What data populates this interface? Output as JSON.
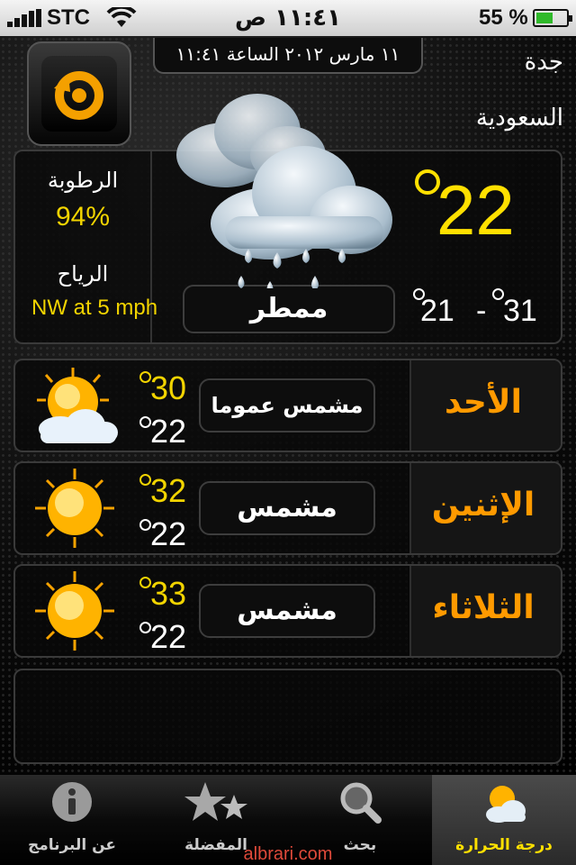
{
  "status_bar": {
    "carrier": "STC",
    "time": "١١:٤١ ص",
    "battery": "55 %",
    "battery_level": 0.55
  },
  "header": {
    "datetime": "١١ مارس ٢٠١٢ الساعة ١١:٤١",
    "city": "جدة",
    "country": "السعودية"
  },
  "current": {
    "humidity_label": "الرطوبة",
    "humidity_value": "94%",
    "wind_label": "الرياح",
    "wind_value": "NW at 5 mph",
    "temp": "22",
    "condition": "ممطر",
    "high": "31",
    "low": "21",
    "icon": "rain-cloud-icon"
  },
  "forecast": [
    {
      "day": "الأحد",
      "condition": "مشمس عموما",
      "high": "30",
      "low": "22",
      "icon": "partly-sunny-icon"
    },
    {
      "day": "الإثنين",
      "condition": "مشمس",
      "high": "32",
      "low": "22",
      "icon": "sun-icon"
    },
    {
      "day": "الثلاثاء",
      "condition": "مشمس",
      "high": "33",
      "low": "22",
      "icon": "sun-icon"
    }
  ],
  "tabs": [
    {
      "label": "عن البرنامج",
      "icon": "info-icon",
      "active": false
    },
    {
      "label": "المفضلة",
      "icon": "stars-icon",
      "active": false
    },
    {
      "label": "بحث",
      "icon": "search-icon",
      "active": false
    },
    {
      "label": "درجة الحرارة",
      "icon": "weather-icon",
      "active": true
    }
  ],
  "watermark": "albrari.com",
  "colors": {
    "accent_yellow": "#f2d400",
    "day_orange": "#ff9a00",
    "battery_green": "#2fb92a"
  }
}
